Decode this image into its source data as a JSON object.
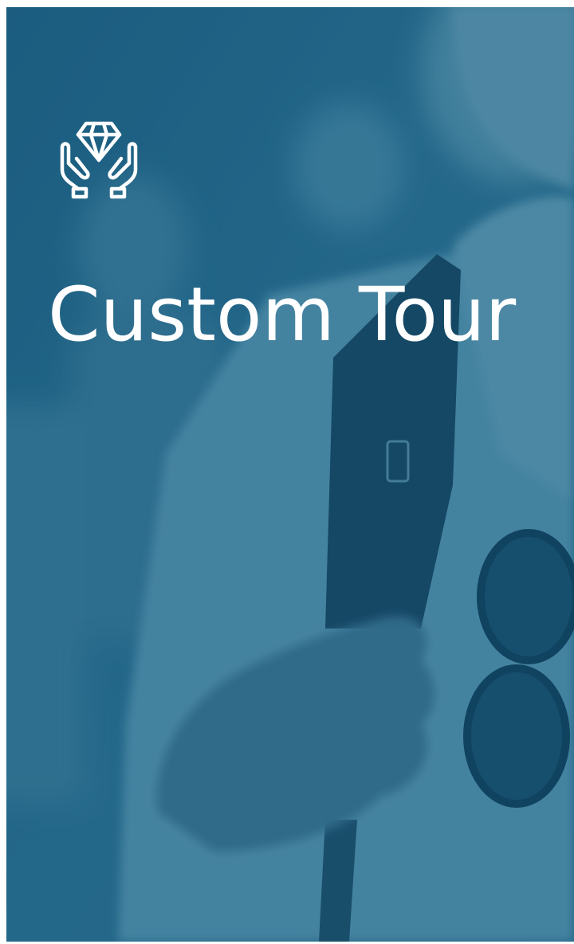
{
  "card": {
    "title": "Custom Tour",
    "icon": "hands-diamond-icon",
    "background_image": "blurred-traveler-photo"
  },
  "colors": {
    "overlay": "#2b6a8a",
    "title_text": "#ffffff",
    "icon_stroke": "#ffffff",
    "page_background": "#ffffff"
  }
}
